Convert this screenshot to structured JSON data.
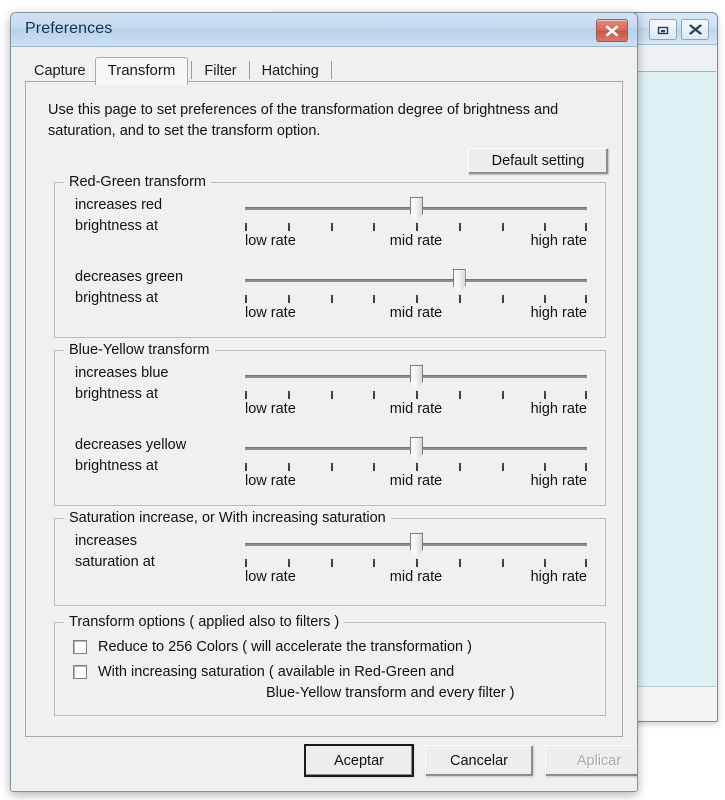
{
  "background_window": {
    "minimize_icon": "minimize-icon",
    "close_icon": "close-icon"
  },
  "dialog": {
    "title": "Preferences",
    "close_icon": "close-icon",
    "tabs": [
      {
        "label": "Capture",
        "selected": false
      },
      {
        "label": "Transform",
        "selected": true
      },
      {
        "label": "Filter",
        "selected": false
      },
      {
        "label": "Hatching",
        "selected": false
      }
    ],
    "description": "Use this page to set preferences of the transformation degree of brightness and saturation, and to set the transform option.",
    "default_setting_label": "Default setting",
    "scale_labels": {
      "low": "low rate",
      "mid": "mid rate",
      "high": "high rate"
    },
    "groups": [
      {
        "legend": "Red-Green transform",
        "sliders": [
          {
            "label": "increases red\nbrightness at",
            "value": 4,
            "min": 0,
            "max": 8,
            "ticks": 9
          },
          {
            "label": "decreases green\nbrightness at",
            "value": 5,
            "min": 0,
            "max": 8,
            "ticks": 9
          }
        ]
      },
      {
        "legend": "Blue-Yellow transform",
        "sliders": [
          {
            "label": "increases blue\nbrightness at",
            "value": 4,
            "min": 0,
            "max": 8,
            "ticks": 9
          },
          {
            "label": "decreases yellow\nbrightness at",
            "value": 4,
            "min": 0,
            "max": 8,
            "ticks": 9
          }
        ]
      },
      {
        "legend": "Saturation increase, or With increasing saturation",
        "sliders": [
          {
            "label": "increases\nsaturation at",
            "value": 4,
            "min": 0,
            "max": 8,
            "ticks": 9
          }
        ]
      }
    ],
    "options": {
      "legend": "Transform options ( applied also to filters )",
      "items": [
        {
          "checked": false,
          "line1": "Reduce to 256 Colors ( will accelerate the transformation )",
          "line2": ""
        },
        {
          "checked": false,
          "line1": "With increasing saturation ( available in Red-Green and",
          "line2": "Blue-Yellow transform and every filter )"
        }
      ]
    },
    "buttons": {
      "ok": "Aceptar",
      "cancel": "Cancelar",
      "apply": "Aplicar",
      "apply_disabled": true
    }
  }
}
